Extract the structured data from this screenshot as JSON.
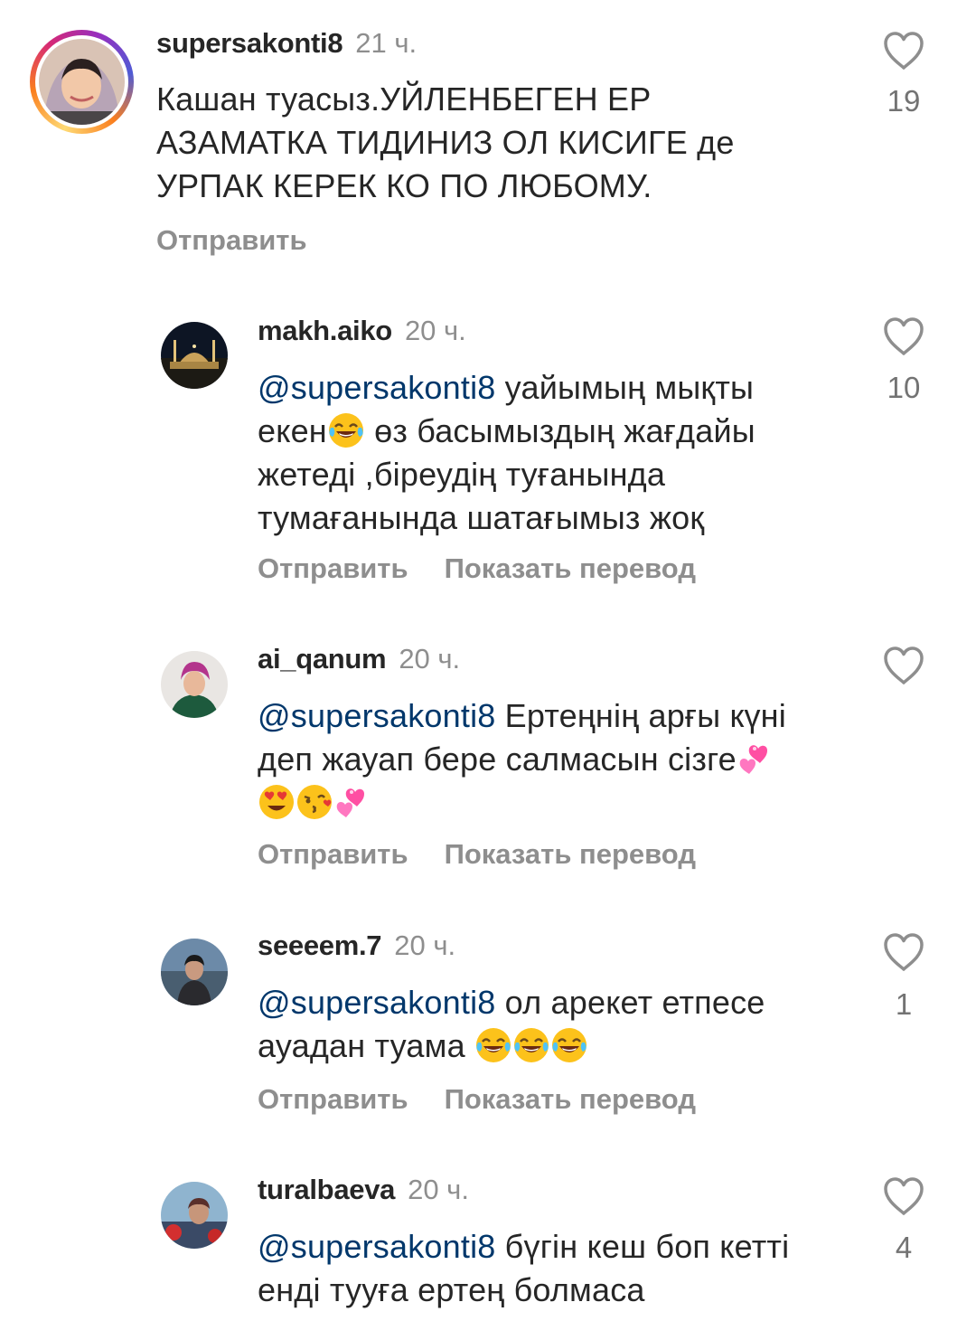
{
  "comments": [
    {
      "username": "supersakonti8",
      "time": "21 ч.",
      "text_lines": [
        "Кашан туасыз.УЙЛЕНБЕГЕН ЕР",
        "АЗАМАТКА ТИДИНИЗ ОЛ КИСИГЕ де",
        "УРПАК КЕРЕК КО ПО ЛЮБОМУ."
      ],
      "like_count": "19",
      "actions": {
        "reply": "Отправить"
      }
    },
    {
      "username": "makh.aiko",
      "time": "20 ч.",
      "mention": "@supersakonti8",
      "text_lines": [
        " уайымың мықты",
        "екен",
        " өз басымыздың жағдайы",
        "жетеді ,біреудің туғанында",
        "тумағанында шатағымыз жоқ"
      ],
      "like_count": "10",
      "actions": {
        "reply": "Отправить",
        "translate": "Показать перевод"
      }
    },
    {
      "username": "ai_qanum",
      "time": "20 ч.",
      "mention": "@supersakonti8",
      "text_lines": [
        " Ертеңнің арғы күні",
        "деп жауап бере салмасын сізге"
      ],
      "like_count": "",
      "actions": {
        "reply": "Отправить",
        "translate": "Показать перевод"
      }
    },
    {
      "username": "seeeem.7",
      "time": "20 ч.",
      "mention": "@supersakonti8",
      "text_lines": [
        " ол арекет етпесе",
        "ауадан туама "
      ],
      "like_count": "1",
      "actions": {
        "reply": "Отправить",
        "translate": "Показать перевод"
      }
    },
    {
      "username": "turalbaeva",
      "time": "20 ч.",
      "mention": "@supersakonti8",
      "text_lines": [
        " бүгін кеш боп кетті",
        "енді тууға ертең болмаса"
      ],
      "like_count": "4",
      "actions": {}
    }
  ],
  "icons": {
    "like": "heart-outline-icon",
    "emoji_laugh": "face-with-tears-of-joy",
    "emoji_hearts": "two-hearts",
    "emoji_heart_eyes": "smiling-face-with-heart-eyes",
    "emoji_kiss": "face-blowing-a-kiss"
  },
  "colors": {
    "text": "#262626",
    "secondary": "#8e8e8e",
    "mention": "#00376b"
  }
}
